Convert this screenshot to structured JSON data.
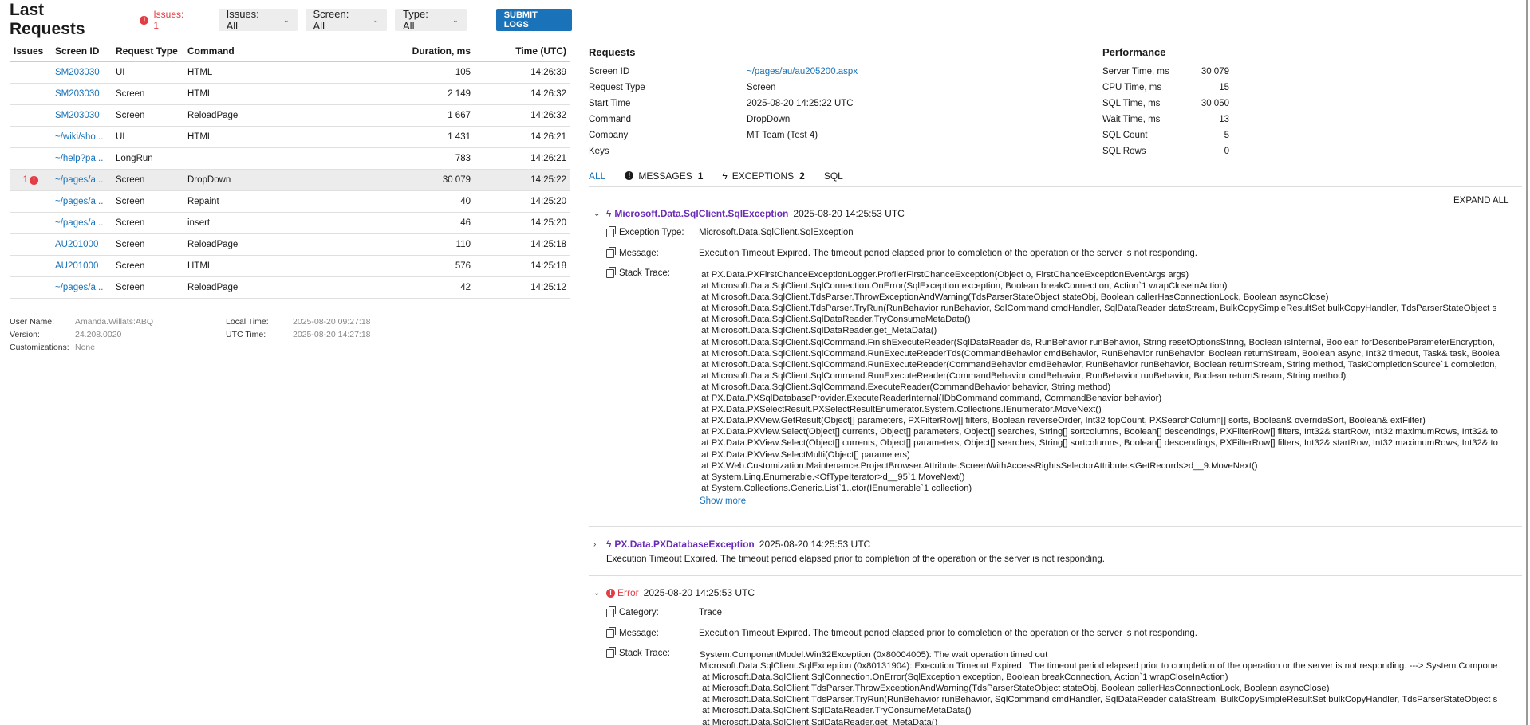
{
  "header": {
    "title": "Last Requests",
    "issues_label": "Issues: 1",
    "issues_filter": "Issues: All",
    "screen_filter": "Screen: All",
    "type_filter": "Type: All",
    "submit_label": "SUBMIT LOGS"
  },
  "table": {
    "columns": [
      "Issues",
      "Screen ID",
      "Request Type",
      "Command",
      "Duration, ms",
      "Time (UTC)"
    ],
    "rows": [
      {
        "issues": "",
        "screen_id": "SM203030",
        "type": "UI",
        "command": "HTML",
        "duration": "105",
        "time": "14:26:39"
      },
      {
        "issues": "",
        "screen_id": "SM203030",
        "type": "Screen",
        "command": "HTML",
        "duration": "2 149",
        "time": "14:26:32"
      },
      {
        "issues": "",
        "screen_id": "SM203030",
        "type": "Screen",
        "command": "ReloadPage",
        "duration": "1 667",
        "time": "14:26:32"
      },
      {
        "issues": "",
        "screen_id": "~/wiki/sho...",
        "type": "UI",
        "command": "HTML",
        "duration": "1 431",
        "time": "14:26:21"
      },
      {
        "issues": "",
        "screen_id": "~/help?pa...",
        "type": "LongRun",
        "command": "",
        "duration": "783",
        "time": "14:26:21"
      },
      {
        "issues": "1",
        "screen_id": "~/pages/a...",
        "type": "Screen",
        "command": "DropDown",
        "duration": "30 079",
        "time": "14:25:22"
      },
      {
        "issues": "",
        "screen_id": "~/pages/a...",
        "type": "Screen",
        "command": "Repaint",
        "duration": "40",
        "time": "14:25:20"
      },
      {
        "issues": "",
        "screen_id": "~/pages/a...",
        "type": "Screen",
        "command": "insert",
        "duration": "46",
        "time": "14:25:20"
      },
      {
        "issues": "",
        "screen_id": "AU201000",
        "type": "Screen",
        "command": "ReloadPage",
        "duration": "110",
        "time": "14:25:18"
      },
      {
        "issues": "",
        "screen_id": "AU201000",
        "type": "Screen",
        "command": "HTML",
        "duration": "576",
        "time": "14:25:18"
      },
      {
        "issues": "",
        "screen_id": "~/pages/a...",
        "type": "Screen",
        "command": "ReloadPage",
        "duration": "42",
        "time": "14:25:12"
      }
    ]
  },
  "userinfo": {
    "user_name_label": "User Name:",
    "user_name": "Amanda.Willats:ABQ",
    "version_label": "Version:",
    "version": "24.208.0020",
    "custom_label": "Customizations:",
    "custom": "None",
    "local_time_label": "Local Time:",
    "local_time": "2025-08-20 09:27:18",
    "utc_time_label": "UTC Time:",
    "utc_time": "2025-08-20 14:27:18"
  },
  "requests": {
    "title": "Requests",
    "items": [
      {
        "label": "Screen ID",
        "value": "~/pages/au/au205200.aspx"
      },
      {
        "label": "Request Type",
        "value": "Screen"
      },
      {
        "label": "Start Time",
        "value": "2025-08-20 14:25:22 UTC"
      },
      {
        "label": "Command",
        "value": "DropDown"
      },
      {
        "label": "Company",
        "value": "MT Team (Test 4)"
      },
      {
        "label": "Keys",
        "value": ""
      }
    ]
  },
  "performance": {
    "title": "Performance",
    "items": [
      {
        "label": "Server Time, ms",
        "value": "30 079"
      },
      {
        "label": "CPU Time, ms",
        "value": "15"
      },
      {
        "label": "SQL Time, ms",
        "value": "30 050"
      },
      {
        "label": "Wait Time, ms",
        "value": "13"
      },
      {
        "label": "SQL Count",
        "value": "5"
      },
      {
        "label": "SQL Rows",
        "value": "0"
      }
    ]
  },
  "tabs": {
    "all": "ALL",
    "messages": "MESSAGES",
    "messages_count": "1",
    "exceptions": "EXCEPTIONS",
    "exceptions_count": "2",
    "sql": "SQL"
  },
  "expand_all": "EXPAND ALL",
  "exc1": {
    "name": "Microsoft.Data.SqlClient.SqlException",
    "time": "2025-08-20 14:25:53 UTC",
    "type_label": "Exception Type:",
    "type_value": "Microsoft.Data.SqlClient.SqlException",
    "message_label": "Message:",
    "message_value": "Execution Timeout Expired.  The timeout period elapsed prior to completion of the operation or the server is not responding.",
    "stack_label": "Stack Trace:",
    "stack": " at PX.Data.PXFirstChanceExceptionLogger.ProfilerFirstChanceException(Object o, FirstChanceExceptionEventArgs args)\n at Microsoft.Data.SqlClient.SqlConnection.OnError(SqlException exception, Boolean breakConnection, Action`1 wrapCloseInAction)\n at Microsoft.Data.SqlClient.TdsParser.ThrowExceptionAndWarning(TdsParserStateObject stateObj, Boolean callerHasConnectionLock, Boolean asyncClose)\n at Microsoft.Data.SqlClient.TdsParser.TryRun(RunBehavior runBehavior, SqlCommand cmdHandler, SqlDataReader dataStream, BulkCopySimpleResultSet bulkCopyHandler, TdsParserStateObject s\n at Microsoft.Data.SqlClient.SqlDataReader.TryConsumeMetaData()\n at Microsoft.Data.SqlClient.SqlDataReader.get_MetaData()\n at Microsoft.Data.SqlClient.SqlCommand.FinishExecuteReader(SqlDataReader ds, RunBehavior runBehavior, String resetOptionsString, Boolean isInternal, Boolean forDescribeParameterEncryption,\n at Microsoft.Data.SqlClient.SqlCommand.RunExecuteReaderTds(CommandBehavior cmdBehavior, RunBehavior runBehavior, Boolean returnStream, Boolean async, Int32 timeout, Task& task, Boolea\n at Microsoft.Data.SqlClient.SqlCommand.RunExecuteReader(CommandBehavior cmdBehavior, RunBehavior runBehavior, Boolean returnStream, String method, TaskCompletionSource`1 completion,\n at Microsoft.Data.SqlClient.SqlCommand.RunExecuteReader(CommandBehavior cmdBehavior, RunBehavior runBehavior, Boolean returnStream, String method)\n at Microsoft.Data.SqlClient.SqlCommand.ExecuteReader(CommandBehavior behavior, String method)\n at PX.Data.PXSqlDatabaseProvider.ExecuteReaderInternal(IDbCommand command, CommandBehavior behavior)\n at PX.Data.PXSelectResult.PXSelectResultEnumerator.System.Collections.IEnumerator.MoveNext()\n at PX.Data.PXView.GetResult(Object[] parameters, PXFilterRow[] filters, Boolean reverseOrder, Int32 topCount, PXSearchColumn[] sorts, Boolean& overrideSort, Boolean& extFilter)\n at PX.Data.PXView.Select(Object[] currents, Object[] parameters, Object[] searches, String[] sortcolumns, Boolean[] descendings, PXFilterRow[] filters, Int32& startRow, Int32 maximumRows, Int32& to\n at PX.Data.PXView.Select(Object[] currents, Object[] parameters, Object[] searches, String[] sortcolumns, Boolean[] descendings, PXFilterRow[] filters, Int32& startRow, Int32 maximumRows, Int32& to\n at PX.Data.PXView.SelectMulti(Object[] parameters)\n at PX.Web.Customization.Maintenance.ProjectBrowser.Attribute.ScreenWithAccessRightsSelectorAttribute.<GetRecords>d__9.MoveNext()\n at System.Linq.Enumerable.<OfTypeIterator>d__95`1.MoveNext()\n at System.Collections.Generic.List`1..ctor(IEnumerable`1 collection)",
    "show_more": "Show more"
  },
  "exc2": {
    "name": "PX.Data.PXDatabaseException",
    "time": "2025-08-20 14:25:53 UTC",
    "message": "Execution Timeout Expired. The timeout period elapsed prior to completion of the operation or the server is not responding."
  },
  "err": {
    "name": "Error",
    "time": "2025-08-20 14:25:53 UTC",
    "category_label": "Category:",
    "category_value": "Trace",
    "message_label": "Message:",
    "message_value": "Execution Timeout Expired.  The timeout period elapsed prior to completion of the operation or the server is not responding.",
    "stack_label": "Stack Trace:",
    "stack": "System.ComponentModel.Win32Exception (0x80004005): The wait operation timed out\nMicrosoft.Data.SqlClient.SqlException (0x80131904): Execution Timeout Expired.  The timeout period elapsed prior to completion of the operation or the server is not responding. ---> System.Compone\n at Microsoft.Data.SqlClient.SqlConnection.OnError(SqlException exception, Boolean breakConnection, Action`1 wrapCloseInAction)\n at Microsoft.Data.SqlClient.TdsParser.ThrowExceptionAndWarning(TdsParserStateObject stateObj, Boolean callerHasConnectionLock, Boolean asyncClose)\n at Microsoft.Data.SqlClient.TdsParser.TryRun(RunBehavior runBehavior, SqlCommand cmdHandler, SqlDataReader dataStream, BulkCopySimpleResultSet bulkCopyHandler, TdsParserStateObject s\n at Microsoft.Data.SqlClient.SqlDataReader.TryConsumeMetaData()\n at Microsoft.Data.SqlClient.SqlDataReader.get_MetaData()"
  },
  "icons": {
    "error": "error-circle-icon",
    "bolt": "lightning-icon",
    "copy": "copy-icon",
    "chevron": "chevron-down-icon"
  },
  "colors": {
    "accent": "#1a73b8",
    "error": "#e23c45",
    "exception": "#6a2ab8"
  }
}
